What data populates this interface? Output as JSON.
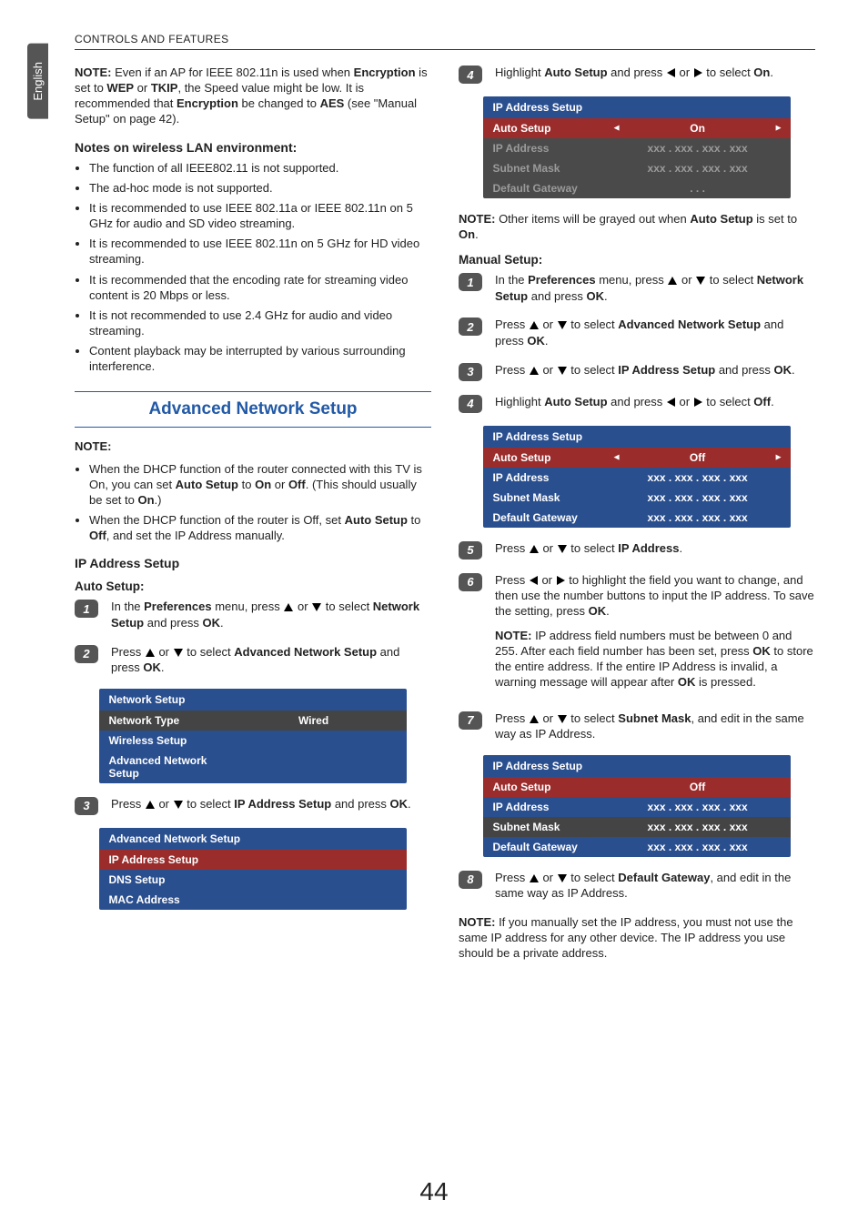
{
  "header": "CONTROLS AND FEATURES",
  "side_tab": "English",
  "page_number": "44",
  "left": {
    "note1_pre": "NOTE:",
    "note1_text_a": " Even if an AP for IEEE 802.11n is used when ",
    "note1_enc": "Encryption",
    "note1_text_b": " is set to ",
    "note1_wep": "WEP",
    "note1_or": " or ",
    "note1_tkip": "TKIP",
    "note1_text_c": ", the Speed value might be low. It is recommended that ",
    "note1_enc2": "Encryption",
    "note1_text_d": " be changed to ",
    "note1_aes": "AES",
    "note1_text_e": " (see \"Manual Setup\" on page 42).",
    "wlan_heading": "Notes on wireless LAN environment:",
    "wlan_bullets": [
      "The function of all IEEE802.11 is not supported.",
      "The ad-hoc mode is not supported.",
      "It is recommended to use IEEE 802.11a or IEEE 802.11n on 5 GHz for audio and SD video streaming.",
      "It is recommended to use IEEE 802.11n on 5 GHz for HD video streaming.",
      "It is recommended that the encoding rate for streaming video content is 20 Mbps or less.",
      "It is not recommended to use 2.4 GHz for audio and video streaming.",
      "Content playback may be interrupted by various surrounding interference."
    ],
    "section_banner": "Advanced Network Setup",
    "note2": "NOTE:",
    "note2_bullets": [
      {
        "a": "When the DHCP function of the router connected with this TV is On, you can set ",
        "b": "Auto Setup",
        "c": " to ",
        "d": "On",
        "e": " or ",
        "f": "Off",
        "g": ". (This should usually be set to ",
        "h": "On",
        "i": ".)"
      },
      {
        "a": "When the DHCP function of the router is Off, set ",
        "b": "Auto Setup",
        "c": " to ",
        "d": "Off",
        "e": ", and set the IP Address manually."
      }
    ],
    "ip_heading": "IP Address Setup",
    "auto_heading": "Auto Setup:",
    "step1": {
      "a": "In the ",
      "b": "Preferences",
      "c": " menu, press ",
      "d": " or ",
      "e": " to select ",
      "f": "Network Setup",
      "g": " and press ",
      "h": "OK",
      "i": "."
    },
    "step2": {
      "a": "Press ",
      "b": " or ",
      "c": " to select ",
      "d": "Advanced Network Setup",
      "e": " and press ",
      "f": "OK",
      "g": "."
    },
    "menu_ns": {
      "title": "Network Setup",
      "rows": [
        {
          "label": "Network Type",
          "value": "Wired"
        },
        {
          "label": "Wireless Setup",
          "value": ""
        },
        {
          "label": "Advanced Network Setup",
          "value": ""
        }
      ]
    },
    "step3": {
      "a": "Press ",
      "b": " or ",
      "c": " to select ",
      "d": "IP Address Setup",
      "e": " and press ",
      "f": "OK",
      "g": "."
    },
    "menu_ans": {
      "title": "Advanced Network Setup",
      "rows": [
        {
          "label": "IP Address Setup"
        },
        {
          "label": "DNS Setup"
        },
        {
          "label": "MAC Address"
        }
      ]
    }
  },
  "right": {
    "step4": {
      "a": "Highlight ",
      "b": "Auto Setup",
      "c": " and press ",
      "d": " or ",
      "e": " to select ",
      "f": "On",
      "g": "."
    },
    "menu_ip_on": {
      "title": "IP Address Setup",
      "auto_label": "Auto Setup",
      "auto_value": "On",
      "rows": [
        {
          "label": "IP Address",
          "value": "xxx  .  xxx  .  xxx  .  xxx"
        },
        {
          "label": "Subnet Mask",
          "value": "xxx  .  xxx  .  xxx  .  xxx"
        },
        {
          "label": "Default Gateway",
          "value": ".         .         ."
        }
      ]
    },
    "note3_a": "NOTE:",
    "note3_b": " Other items will be grayed out when ",
    "note3_c": "Auto Setup",
    "note3_d": " is set to ",
    "note3_e": "On",
    "note3_f": ".",
    "manual_heading": "Manual Setup:",
    "mstep1": {
      "a": "In the ",
      "b": "Preferences",
      "c": " menu, press ",
      "d": " or ",
      "e": " to select ",
      "f": "Network Setup",
      "g": " and press ",
      "h": "OK",
      "i": "."
    },
    "mstep2": {
      "a": "Press ",
      "b": " or ",
      "c": " to select ",
      "d": "Advanced Network Setup",
      "e": " and press ",
      "f": "OK",
      "g": "."
    },
    "mstep3": {
      "a": "Press ",
      "b": " or ",
      "c": " to select ",
      "d": "IP Address Setup",
      "e": " and press ",
      "f": "OK",
      "g": "."
    },
    "mstep4": {
      "a": "Highlight ",
      "b": "Auto Setup",
      "c": " and press ",
      "d": " or ",
      "e": " to select ",
      "f": "Off",
      "g": "."
    },
    "menu_ip_off": {
      "title": "IP Address Setup",
      "auto_label": "Auto Setup",
      "auto_value": "Off",
      "rows": [
        {
          "label": "IP Address",
          "value": "xxx  .  xxx  .  xxx  .  xxx"
        },
        {
          "label": "Subnet Mask",
          "value": "xxx  .  xxx  .  xxx  .  xxx"
        },
        {
          "label": "Default Gateway",
          "value": "xxx  .  xxx  .  xxx  .  xxx"
        }
      ]
    },
    "mstep5": {
      "a": "Press ",
      "b": " or ",
      "c": " to select ",
      "d": "IP Address",
      "e": "."
    },
    "mstep6": {
      "a": "Press ",
      "b": " or ",
      "c": " to highlight the field you want to change, and then use the number buttons to input the IP address. To save the setting, press ",
      "d": "OK",
      "e": "."
    },
    "mnote6_a": "NOTE:",
    "mnote6_b": " IP address field numbers must be between 0 and 255. After each field number has been set, press ",
    "mnote6_c": "OK",
    "mnote6_d": " to store the entire address. If the entire IP Address is invalid, a warning message will appear after ",
    "mnote6_e": "OK",
    "mnote6_f": " is pressed.",
    "mstep7": {
      "a": "Press ",
      "b": " or ",
      "c": " to select ",
      "d": "Subnet Mask",
      "e": ", and edit in the same way as IP Address."
    },
    "menu_ip_off2": {
      "title": "IP Address Setup",
      "auto_label": "Auto Setup",
      "auto_value": "Off",
      "rows": [
        {
          "label": "IP Address",
          "value": "xxx  .  xxx  .  xxx  .  xxx"
        },
        {
          "label": "Subnet Mask",
          "value": "xxx  .  xxx  .  xxx  .  xxx",
          "highlight": true
        },
        {
          "label": "Default Gateway",
          "value": "xxx  .  xxx  .  xxx  .  xxx"
        }
      ]
    },
    "mstep8": {
      "a": "Press ",
      "b": " or ",
      "c": " to select ",
      "d": "Default Gateway",
      "e": ", and edit in the same way as IP Address."
    },
    "final_note_a": "NOTE:",
    "final_note_b": " If you manually set the IP address, you must not use the same IP address for any other device. The IP address you use should be a private address."
  }
}
